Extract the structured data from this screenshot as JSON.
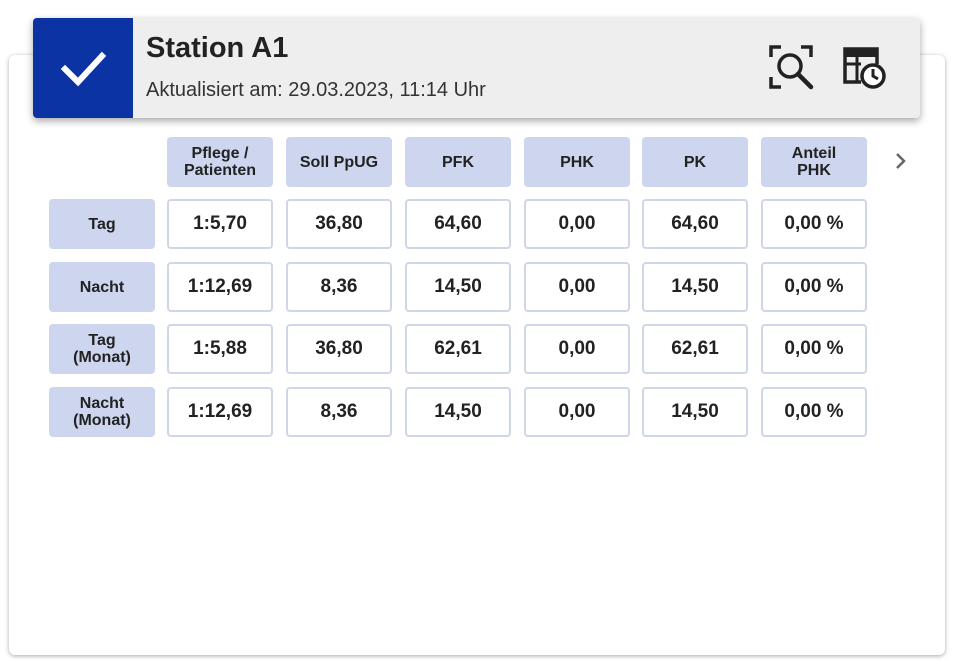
{
  "header": {
    "status_icon": "check-icon",
    "title": "Station A1",
    "updated": "Aktualisiert am: 29.03.2023, 11:14 Uhr",
    "search_icon": "search-icon",
    "history_icon": "table-clock-icon",
    "accent_color": "#0b33a3"
  },
  "table": {
    "columns": [
      "Pflege /\nPatienten",
      "Soll PpUG",
      "PFK",
      "PHK",
      "PK",
      "Anteil\nPHK"
    ],
    "rows": [
      {
        "label": "Tag",
        "values": [
          "1:5,70",
          "36,80",
          "64,60",
          "0,00",
          "64,60",
          "0,00 %"
        ]
      },
      {
        "label": "Nacht",
        "values": [
          "1:12,69",
          "8,36",
          "14,50",
          "0,00",
          "14,50",
          "0,00 %"
        ]
      },
      {
        "label": "Tag\n(Monat)",
        "values": [
          "1:5,88",
          "36,80",
          "62,61",
          "0,00",
          "62,61",
          "0,00 %"
        ]
      },
      {
        "label": "Nacht\n(Monat)",
        "values": [
          "1:12,69",
          "8,36",
          "14,50",
          "0,00",
          "14,50",
          "0,00 %"
        ]
      }
    ],
    "next_icon": "chevron-right-icon"
  }
}
